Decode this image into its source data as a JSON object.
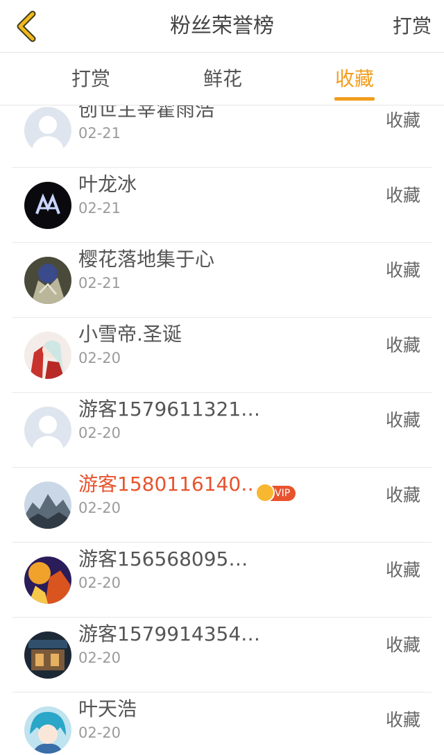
{
  "header": {
    "title": "粉丝荣誉榜",
    "right_action": "打赏",
    "back_icon": "chevron-left-icon",
    "accent_color": "#f29d1e"
  },
  "tabs": [
    {
      "label": "打赏",
      "active": false
    },
    {
      "label": "鲜花",
      "active": false
    },
    {
      "label": "收藏",
      "active": true
    }
  ],
  "list": {
    "items": [
      {
        "name": "创世主宰霍雨浩",
        "date": "02-21",
        "action": "收藏",
        "vip": false,
        "avatar": "default-avatar"
      },
      {
        "name": "叶龙冰",
        "date": "02-21",
        "action": "收藏",
        "vip": false,
        "avatar": "dark-logo-avatar"
      },
      {
        "name": "樱花落地集于心",
        "date": "02-21",
        "action": "收藏",
        "vip": false,
        "avatar": "anime-avatar"
      },
      {
        "name": "小雪帝.圣诞",
        "date": "02-20",
        "action": "收藏",
        "vip": false,
        "avatar": "christmas-avatar"
      },
      {
        "name": "游客1579611321…",
        "date": "02-20",
        "action": "收藏",
        "vip": false,
        "avatar": "default-avatar"
      },
      {
        "name": "游客1580116140…",
        "date": "02-20",
        "action": "收藏",
        "vip": true,
        "vip_label": "VIP",
        "avatar": "landscape-avatar"
      },
      {
        "name": "游客156568095…",
        "date": "02-20",
        "action": "收藏",
        "vip": false,
        "avatar": "colorful-avatar"
      },
      {
        "name": "游客1579914354…",
        "date": "02-20",
        "action": "收藏",
        "vip": false,
        "avatar": "shop-avatar"
      },
      {
        "name": "叶天浩",
        "date": "02-20",
        "action": "收藏",
        "vip": false,
        "avatar": "anime-boy-avatar"
      }
    ]
  }
}
